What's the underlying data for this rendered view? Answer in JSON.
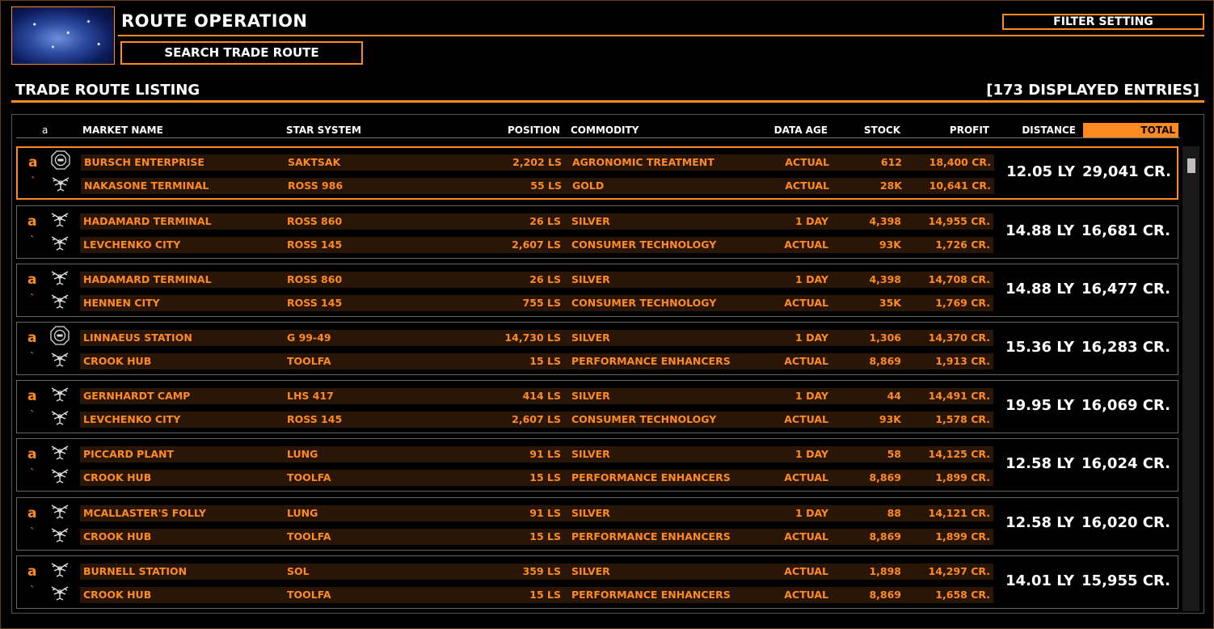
{
  "header": {
    "title": "ROUTE OPERATION",
    "search_label": "SEARCH TRADE ROUTE",
    "filter_label": "FILTER SETTING"
  },
  "listing": {
    "title": "TRADE ROUTE LISTING",
    "entries_count": "[173 DISPLAYED ENTRIES]"
  },
  "columns": {
    "mark": "a",
    "market": "MARKET NAME",
    "system": "STAR SYSTEM",
    "position": "POSITION",
    "commodity": "COMMODITY",
    "data_age": "DATA AGE",
    "stock": "STOCK",
    "profit": "PROFIT",
    "distance": "DISTANCE",
    "total": "TOTAL"
  },
  "routes": [
    {
      "selected": true,
      "mark": "a",
      "mark2": "`",
      "distance": "12.05 LY",
      "total": "29,041 CR.",
      "legs": [
        {
          "icon": "starport-icon",
          "market": "BURSCH ENTERPRISE",
          "system": "SAKTSAK",
          "position": "2,202 LS",
          "commodity": "AGRONOMIC TREATMENT",
          "age": "ACTUAL",
          "stock": "612",
          "profit": "18,400 CR."
        },
        {
          "icon": "outpost-icon",
          "market": "NAKASONE TERMINAL",
          "system": "ROSS 986",
          "position": "55 LS",
          "commodity": "GOLD",
          "age": "ACTUAL",
          "stock": "28K",
          "profit": "10,641 CR."
        }
      ]
    },
    {
      "selected": false,
      "mark": "a",
      "mark2": "`",
      "distance": "14.88 LY",
      "total": "16,681 CR.",
      "legs": [
        {
          "icon": "outpost-icon",
          "market": "HADAMARD TERMINAL",
          "system": "ROSS 860",
          "position": "26 LS",
          "commodity": "SILVER",
          "age": "1 DAY",
          "stock": "4,398",
          "profit": "14,955 CR."
        },
        {
          "icon": "outpost-icon",
          "market": "LEVCHENKO CITY",
          "system": "ROSS 145",
          "position": "2,607 LS",
          "commodity": "CONSUMER TECHNOLOGY",
          "age": "ACTUAL",
          "stock": "93K",
          "profit": "1,726 CR."
        }
      ]
    },
    {
      "selected": false,
      "mark": "a",
      "mark2": "`",
      "distance": "14.88 LY",
      "total": "16,477 CR.",
      "legs": [
        {
          "icon": "outpost-icon",
          "market": "HADAMARD TERMINAL",
          "system": "ROSS 860",
          "position": "26 LS",
          "commodity": "SILVER",
          "age": "1 DAY",
          "stock": "4,398",
          "profit": "14,708 CR."
        },
        {
          "icon": "outpost-icon",
          "market": "HENNEN CITY",
          "system": "ROSS 145",
          "position": "755 LS",
          "commodity": "CONSUMER TECHNOLOGY",
          "age": "ACTUAL",
          "stock": "35K",
          "profit": "1,769 CR."
        }
      ]
    },
    {
      "selected": false,
      "mark": "a",
      "mark2": "`",
      "distance": "15.36 LY",
      "total": "16,283 CR.",
      "legs": [
        {
          "icon": "starport-icon",
          "market": "LINNAEUS STATION",
          "system": "G 99-49",
          "position": "14,730 LS",
          "commodity": "SILVER",
          "age": "1 DAY",
          "stock": "1,306",
          "profit": "14,370 CR."
        },
        {
          "icon": "outpost-icon",
          "market": "CROOK HUB",
          "system": "TOOLFA",
          "position": "15 LS",
          "commodity": "PERFORMANCE ENHANCERS",
          "age": "ACTUAL",
          "stock": "8,869",
          "profit": "1,913 CR."
        }
      ]
    },
    {
      "selected": false,
      "mark": "a",
      "mark2": "`",
      "distance": "19.95 LY",
      "total": "16,069 CR.",
      "legs": [
        {
          "icon": "outpost-icon",
          "market": "GERNHARDT CAMP",
          "system": "LHS 417",
          "position": "414 LS",
          "commodity": "SILVER",
          "age": "1 DAY",
          "stock": "44",
          "profit": "14,491 CR."
        },
        {
          "icon": "outpost-icon",
          "market": "LEVCHENKO CITY",
          "system": "ROSS 145",
          "position": "2,607 LS",
          "commodity": "CONSUMER TECHNOLOGY",
          "age": "ACTUAL",
          "stock": "93K",
          "profit": "1,578 CR."
        }
      ]
    },
    {
      "selected": false,
      "mark": "a",
      "mark2": "`",
      "distance": "12.58 LY",
      "total": "16,024 CR.",
      "legs": [
        {
          "icon": "outpost-icon",
          "market": "PICCARD PLANT",
          "system": "LUNG",
          "position": "91 LS",
          "commodity": "SILVER",
          "age": "1 DAY",
          "stock": "58",
          "profit": "14,125 CR."
        },
        {
          "icon": "outpost-icon",
          "market": "CROOK HUB",
          "system": "TOOLFA",
          "position": "15 LS",
          "commodity": "PERFORMANCE ENHANCERS",
          "age": "ACTUAL",
          "stock": "8,869",
          "profit": "1,899 CR."
        }
      ]
    },
    {
      "selected": false,
      "mark": "a",
      "mark2": "`",
      "distance": "12.58 LY",
      "total": "16,020 CR.",
      "legs": [
        {
          "icon": "outpost-icon",
          "market": "MCALLASTER'S FOLLY",
          "system": "LUNG",
          "position": "91 LS",
          "commodity": "SILVER",
          "age": "1 DAY",
          "stock": "88",
          "profit": "14,121 CR."
        },
        {
          "icon": "outpost-icon",
          "market": "CROOK HUB",
          "system": "TOOLFA",
          "position": "15 LS",
          "commodity": "PERFORMANCE ENHANCERS",
          "age": "ACTUAL",
          "stock": "8,869",
          "profit": "1,899 CR."
        }
      ]
    },
    {
      "selected": false,
      "mark": "a",
      "mark2": "`",
      "distance": "14.01 LY",
      "total": "15,955 CR.",
      "legs": [
        {
          "icon": "outpost-icon",
          "market": "BURNELL STATION",
          "system": "SOL",
          "position": "359 LS",
          "commodity": "SILVER",
          "age": "ACTUAL",
          "stock": "1,898",
          "profit": "14,297 CR."
        },
        {
          "icon": "outpost-icon",
          "market": "CROOK HUB",
          "system": "TOOLFA",
          "position": "15 LS",
          "commodity": "PERFORMANCE ENHANCERS",
          "age": "ACTUAL",
          "stock": "8,869",
          "profit": "1,658 CR."
        }
      ]
    }
  ]
}
